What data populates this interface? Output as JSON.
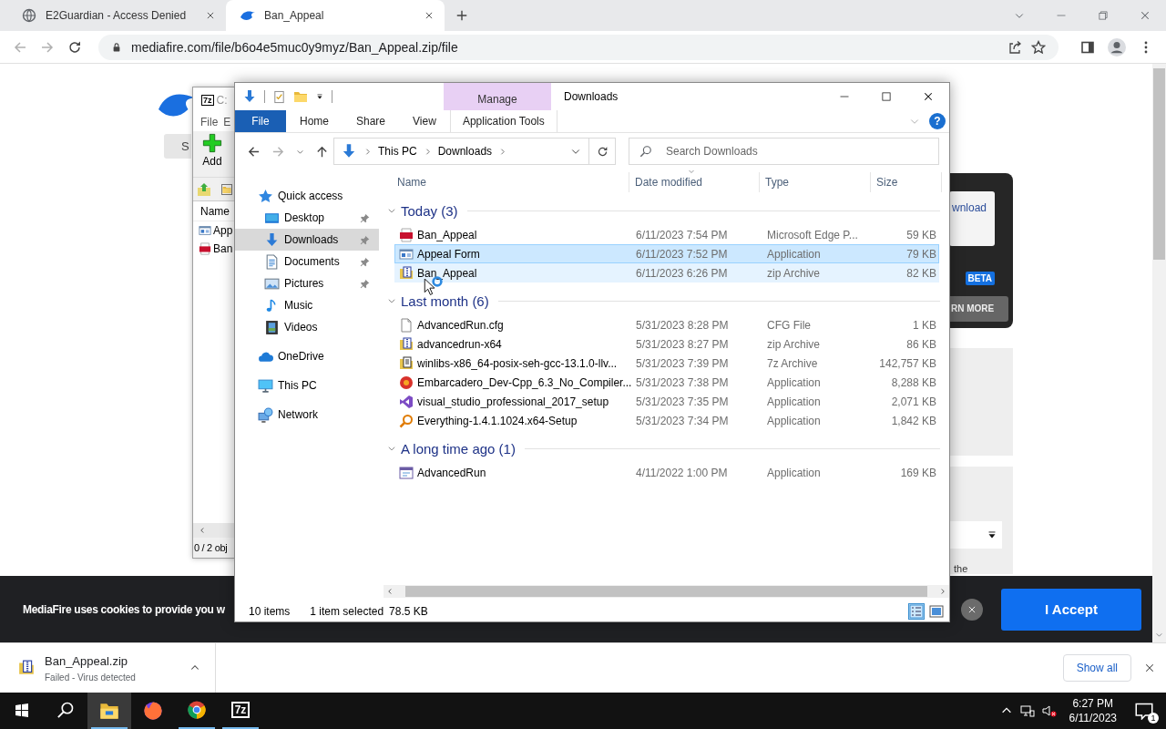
{
  "browser": {
    "tabs": [
      {
        "title": "E2Guardian - Access Denied",
        "kind": "globe",
        "selected": false
      },
      {
        "title": "Ban_Appeal",
        "kind": "flame",
        "selected": true
      }
    ],
    "url": "mediafire.com/file/b6o4e5muc0y9myz/Ban_Appeal.zip/file"
  },
  "page": {
    "side_button": "S",
    "card_link": "wnload",
    "badge": "BETA",
    "learn_more": "RN MORE",
    "note": "the"
  },
  "sevenzip_window": {
    "logo": "7z",
    "title": "C:",
    "menu": [
      "File",
      "E"
    ],
    "add_button": "Add",
    "column": "Name",
    "items": [
      {
        "name": "App",
        "kind": "app"
      },
      {
        "name": "Ban",
        "kind": "pdf"
      }
    ],
    "status": "0 / 2 obj"
  },
  "explorer": {
    "title": "Downloads",
    "context_group": "Manage",
    "help": "?",
    "tabs": [
      {
        "label": "File",
        "kind": "file",
        "selected": false
      },
      {
        "label": "Home",
        "kind": "tab",
        "selected": false
      },
      {
        "label": "Share",
        "kind": "tab",
        "selected": false
      },
      {
        "label": "View",
        "kind": "tab",
        "selected": false
      },
      {
        "label": "Application Tools",
        "kind": "context",
        "selected": false
      }
    ],
    "breadcrumb": [
      "This PC",
      "Downloads"
    ],
    "search": {
      "placeholder": "Search Downloads"
    },
    "nav": [
      {
        "label": "Quick access",
        "kind": "star",
        "pinned": false,
        "selected": false,
        "children": [
          {
            "label": "Desktop",
            "kind": "desktop",
            "pinned": true,
            "selected": false
          },
          {
            "label": "Downloads",
            "kind": "downloads",
            "pinned": true,
            "selected": true
          },
          {
            "label": "Documents",
            "kind": "documents",
            "pinned": true,
            "selected": false
          },
          {
            "label": "Pictures",
            "kind": "pictures",
            "pinned": true,
            "selected": false
          },
          {
            "label": "Music",
            "kind": "music",
            "pinned": false,
            "selected": false
          },
          {
            "label": "Videos",
            "kind": "videos",
            "pinned": false,
            "selected": false
          }
        ]
      },
      {
        "label": "OneDrive",
        "kind": "cloud",
        "pinned": false,
        "selected": false
      },
      {
        "label": "This PC",
        "kind": "pc",
        "pinned": false,
        "selected": false
      },
      {
        "label": "Network",
        "kind": "network",
        "pinned": false,
        "selected": false
      }
    ],
    "columns": [
      {
        "label": "Name",
        "sorted": false
      },
      {
        "label": "Date modified",
        "sorted": true
      },
      {
        "label": "Type",
        "sorted": false
      },
      {
        "label": "Size",
        "sorted": false
      }
    ],
    "groups": [
      {
        "title": "Today (3)",
        "expanded": true,
        "rows": [
          {
            "name": "Ban_Appeal",
            "date": "6/11/2023 7:54 PM",
            "type": "Microsoft Edge P...",
            "size": "59 KB",
            "kind": "pdf",
            "selected": false,
            "hovered": false
          },
          {
            "name": "Appeal Form",
            "date": "6/11/2023 7:52 PM",
            "type": "Application",
            "size": "79 KB",
            "kind": "app",
            "selected": true,
            "hovered": false
          },
          {
            "name": "Ban_Appeal",
            "date": "6/11/2023 6:26 PM",
            "type": "zip Archive",
            "size": "82 KB",
            "kind": "zip",
            "selected": false,
            "hovered": true
          }
        ]
      },
      {
        "title": "Last month (6)",
        "expanded": true,
        "rows": [
          {
            "name": "AdvancedRun.cfg",
            "date": "5/31/2023 8:28 PM",
            "type": "CFG File",
            "size": "1 KB",
            "kind": "doc",
            "selected": false,
            "hovered": false
          },
          {
            "name": "advancedrun-x64",
            "date": "5/31/2023 8:27 PM",
            "type": "zip Archive",
            "size": "86 KB",
            "kind": "zip",
            "selected": false,
            "hovered": false
          },
          {
            "name": "winlibs-x86_64-posix-seh-gcc-13.1.0-llv...",
            "date": "5/31/2023 7:39 PM",
            "type": "7z Archive",
            "size": "142,757 KB",
            "kind": "archive",
            "selected": false,
            "hovered": false
          },
          {
            "name": "Embarcadero_Dev-Cpp_6.3_No_Compiler...",
            "date": "5/31/2023 7:38 PM",
            "type": "Application",
            "size": "8,288 KB",
            "kind": "devcpp",
            "selected": false,
            "hovered": false
          },
          {
            "name": "visual_studio_professional_2017_setup",
            "date": "5/31/2023 7:35 PM",
            "type": "Application",
            "size": "2,071 KB",
            "kind": "vs",
            "selected": false,
            "hovered": false
          },
          {
            "name": "Everything-1.4.1.1024.x64-Setup",
            "date": "5/31/2023 7:34 PM",
            "type": "Application",
            "size": "1,842 KB",
            "kind": "magnifier",
            "selected": false,
            "hovered": false
          }
        ]
      },
      {
        "title": "A long time ago (1)",
        "expanded": true,
        "rows": [
          {
            "name": "AdvancedRun",
            "date": "4/11/2022 1:00 PM",
            "type": "Application",
            "size": "169 KB",
            "kind": "advrun",
            "selected": false,
            "hovered": false
          }
        ]
      }
    ],
    "status": {
      "count": "10 items",
      "selection": "1 item selected",
      "size": "78.5 KB"
    },
    "view_modes": [
      {
        "kind": "details",
        "selected": true
      },
      {
        "kind": "tiles",
        "selected": false
      }
    ]
  },
  "cookie_banner": {
    "text": "MediaFire uses cookies to provide you w",
    "accept": "I Accept"
  },
  "download_shelf": {
    "file": "Ban_Appeal.zip",
    "status": "Failed - Virus detected",
    "show_all": "Show all"
  },
  "taskbar": {
    "apps": [
      {
        "kind": "explorer",
        "selected": true,
        "running": true
      },
      {
        "kind": "firefox",
        "selected": false,
        "running": false
      },
      {
        "kind": "chrome",
        "selected": false,
        "running": true
      },
      {
        "kind": "sevenzip",
        "label": "7z",
        "selected": false,
        "running": true
      }
    ],
    "time": "6:27 PM",
    "date": "6/11/2023",
    "notifications": "1"
  }
}
